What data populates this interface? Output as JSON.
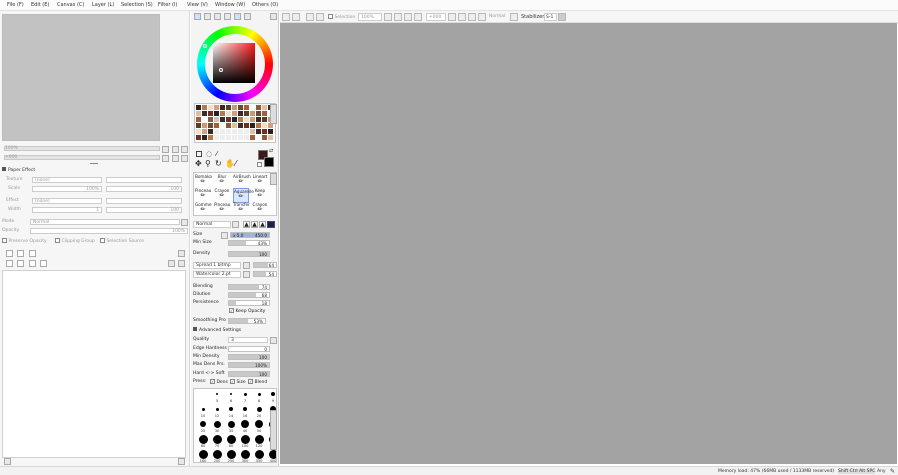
{
  "menubar": {
    "items": [
      "File (F)",
      "Edit (E)",
      "Canvas (C)",
      "Layer (L)",
      "Selection (S)",
      "Filter (I)",
      "View (V)",
      "Window (W)",
      "Others (O)"
    ]
  },
  "left_panel": {
    "zoom_field": "100%",
    "angle_field": "+000",
    "paper_effect_title": "Paper Effect",
    "texture_label": "Texture",
    "texture_value": "(none)",
    "texture_scale_label": "Scale",
    "texture_scale_value": "100%",
    "texture_strength_label": "Strength",
    "texture_strength_value": "100",
    "effect_label": "Effect",
    "effect_value": "(none)",
    "effect_width_label": "Width",
    "effect_width_value": "1",
    "effect_strength_value": "100",
    "mode_label": "Mode",
    "mode_value": "Normal",
    "opacity_label": "Opacity",
    "opacity_value": "100%",
    "preserve_opacity": "Preserve Opacity",
    "clipping_group": "Clipping Group",
    "selection_source": "Selection Source"
  },
  "tool_panel": {
    "brush_tools": [
      [
        "Bomaka",
        "Blur",
        "AirBrush",
        "Lineart"
      ],
      [
        "Pinceau",
        "Crayon",
        "Aquarelle",
        "Keep"
      ],
      [
        "Gomme",
        "Pinceau",
        "Transfer",
        "Crayon"
      ]
    ],
    "brush_sub_labels": [
      "",
      "",
      "",
      "",
      "2",
      "2",
      "1",
      ""
    ],
    "blend_mode": "Normal",
    "size_label": "Size",
    "size_multiplier": "x 5.0",
    "size_value": "450.0",
    "min_size_label": "Min Size",
    "min_size_value": "43%",
    "density_label": "Density",
    "density_value": "100",
    "shape_label": "Spread 1 bitmp",
    "shape_value": "64",
    "texture_label": "Watercolor 2.pt",
    "texture_value": "54",
    "blending_label": "Blending",
    "blending_value": "74",
    "dilution_label": "Dilution",
    "dilution_value": "68",
    "persistence_label": "Persistence",
    "persistence_value": "18",
    "keep_opacity": "Keep Opacity",
    "smoothing_label": "Smoothing Pro",
    "smoothing_value": "53%",
    "advanced_settings": "Advanced Settings",
    "quality_label": "Quality",
    "quality_value": "3",
    "edge_hardness_label": "Edge Hardness",
    "edge_hardness_value": "0",
    "min_density_label": "Min Density",
    "min_density_value": "100",
    "max_dens_prs_label": "Max Dens Prs.",
    "max_dens_prs_value": "100%",
    "hard_soft_label": "Hard <-> Soft",
    "hard_soft_value": "100",
    "press_label": "Press:",
    "press_dens": "Dens",
    "press_size": "Size",
    "press_blend": "Blend",
    "brush_sizes": [
      [
        "",
        "5",
        "6",
        "7",
        "8",
        "9"
      ],
      [
        "10",
        "12",
        "14",
        "16",
        "20",
        "25"
      ],
      [
        "25",
        "30",
        "35",
        "40",
        "50",
        "60"
      ],
      [
        "60",
        "70",
        "80",
        "100",
        "120",
        "150"
      ],
      [
        "160",
        "200",
        "250",
        "300",
        "350",
        "400"
      ]
    ]
  },
  "toolbar": {
    "selection_label": "Selection",
    "zoom_value": "100%",
    "angle_value": "+000",
    "normal_label": "Normal",
    "stabilizer_label": "Stabilizer",
    "stabilizer_value": "S-1"
  },
  "status": {
    "memory": "Memory load: 47% (66MB used / 1133MB reserved)",
    "keys": "Shift Ctrl Alt SPC",
    "any": "Any"
  },
  "colors": {
    "canvas_bg": "#a3a3a3",
    "navigator_bg": "#c2c2c2",
    "primary_color": "#3a1a1a",
    "secondary_color": "#000000"
  }
}
